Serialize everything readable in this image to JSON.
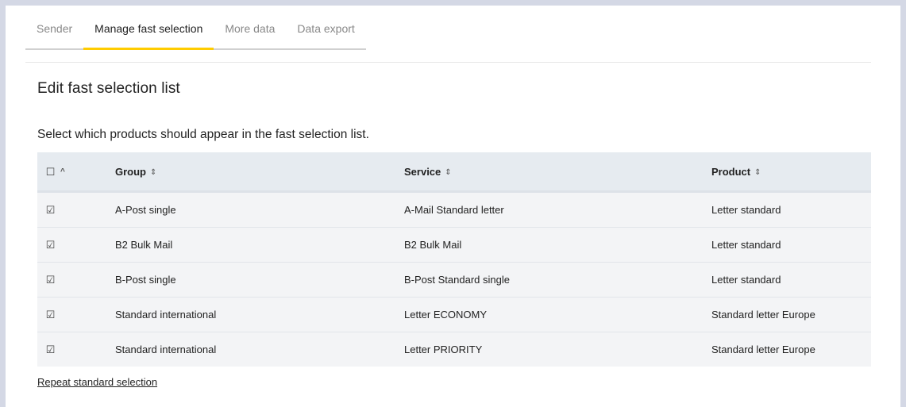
{
  "tabs": [
    {
      "label": "Sender",
      "active": false
    },
    {
      "label": "Manage fast selection",
      "active": true
    },
    {
      "label": "More data",
      "active": false
    },
    {
      "label": "Data export",
      "active": false
    }
  ],
  "colors": {
    "active_tab_underline": "#ffcc00",
    "header_bg": "#e6ebf0",
    "row_bg": "#f3f4f6",
    "page_frame": "#d4d8e5"
  },
  "section": {
    "title": "Edit fast selection list",
    "intro": "Select which products should appear in the fast selection list."
  },
  "table": {
    "select_all_checked": false,
    "columns": {
      "select": "",
      "group": "Group",
      "service": "Service",
      "product": "Product"
    },
    "sort_glyph": "⇕",
    "caret_glyph": "^",
    "rows": [
      {
        "checked": true,
        "group": "A-Post single",
        "service": "A-Mail Standard letter",
        "product": "Letter standard"
      },
      {
        "checked": true,
        "group": "B2 Bulk Mail",
        "service": "B2 Bulk Mail",
        "product": "Letter standard"
      },
      {
        "checked": true,
        "group": "B-Post single",
        "service": "B-Post Standard single",
        "product": "Letter standard"
      },
      {
        "checked": true,
        "group": "Standard international",
        "service": "Letter ECONOMY",
        "product": "Standard letter Europe"
      },
      {
        "checked": true,
        "group": "Standard international",
        "service": "Letter PRIORITY",
        "product": "Standard letter Europe"
      }
    ]
  },
  "footer": {
    "repeat_link": "Repeat standard selection"
  }
}
